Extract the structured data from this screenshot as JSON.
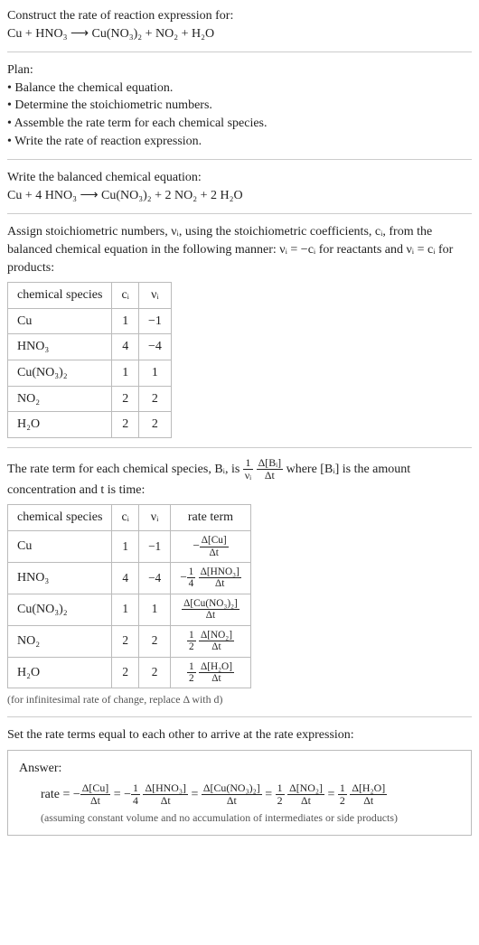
{
  "problem": {
    "title": "Construct the rate of reaction expression for:",
    "equation": "Cu + HNO₃ ⟶ Cu(NO₃)₂ + NO₂ + H₂O"
  },
  "plan": {
    "title": "Plan:",
    "bullets": [
      "Balance the chemical equation.",
      "Determine the stoichiometric numbers.",
      "Assemble the rate term for each chemical species.",
      "Write the rate of reaction expression."
    ]
  },
  "balanced": {
    "title": "Write the balanced chemical equation:",
    "equation": "Cu + 4 HNO₃ ⟶ Cu(NO₃)₂ + 2 NO₂ + 2 H₂O"
  },
  "stoich": {
    "intro_a": "Assign stoichiometric numbers, νᵢ, using the stoichiometric coefficients, cᵢ, from the balanced chemical equation in the following manner: νᵢ = −cᵢ for reactants and νᵢ = cᵢ for products:",
    "headers": {
      "species": "chemical species",
      "c": "cᵢ",
      "nu": "νᵢ"
    },
    "rows": [
      {
        "species": "Cu",
        "c": "1",
        "nu": "−1"
      },
      {
        "species": "HNO₃",
        "c": "4",
        "nu": "−4"
      },
      {
        "species": "Cu(NO₃)₂",
        "c": "1",
        "nu": "1"
      },
      {
        "species": "NO₂",
        "c": "2",
        "nu": "2"
      },
      {
        "species": "H₂O",
        "c": "2",
        "nu": "2"
      }
    ]
  },
  "rate_intro": {
    "part1": "The rate term for each chemical species, Bᵢ, is ",
    "part2": " where [Bᵢ] is the amount concentration and t is time:"
  },
  "rate_table": {
    "headers": {
      "species": "chemical species",
      "c": "cᵢ",
      "nu": "νᵢ",
      "term": "rate term"
    },
    "rows": [
      {
        "species": "Cu",
        "c": "1",
        "nu": "−1",
        "term_num": "Δ[Cu]",
        "term_prefix": "−",
        "term_coef_num": "",
        "term_coef_den": ""
      },
      {
        "species": "HNO₃",
        "c": "4",
        "nu": "−4",
        "term_num": "Δ[HNO₃]",
        "term_prefix": "−",
        "term_coef_num": "1",
        "term_coef_den": "4"
      },
      {
        "species": "Cu(NO₃)₂",
        "c": "1",
        "nu": "1",
        "term_num": "Δ[Cu(NO₃)₂]",
        "term_prefix": "",
        "term_coef_num": "",
        "term_coef_den": ""
      },
      {
        "species": "NO₂",
        "c": "2",
        "nu": "2",
        "term_num": "Δ[NO₂]",
        "term_prefix": "",
        "term_coef_num": "1",
        "term_coef_den": "2"
      },
      {
        "species": "H₂O",
        "c": "2",
        "nu": "2",
        "term_num": "Δ[H₂O]",
        "term_prefix": "",
        "term_coef_num": "1",
        "term_coef_den": "2"
      }
    ],
    "note": "(for infinitesimal rate of change, replace Δ with d)"
  },
  "final": {
    "title": "Set the rate terms equal to each other to arrive at the rate expression:",
    "answer_label": "Answer:",
    "rate_label": "rate = ",
    "terms": [
      {
        "prefix": "−",
        "coef_num": "",
        "coef_den": "",
        "num": "Δ[Cu]"
      },
      {
        "prefix": "−",
        "coef_num": "1",
        "coef_den": "4",
        "num": "Δ[HNO₃]"
      },
      {
        "prefix": "",
        "coef_num": "",
        "coef_den": "",
        "num": "Δ[Cu(NO₃)₂]"
      },
      {
        "prefix": "",
        "coef_num": "1",
        "coef_den": "2",
        "num": "Δ[NO₂]"
      },
      {
        "prefix": "",
        "coef_num": "1",
        "coef_den": "2",
        "num": "Δ[H₂O]"
      }
    ],
    "note": "(assuming constant volume and no accumulation of intermediates or side products)"
  },
  "chart_data": {
    "type": "table",
    "tables": [
      {
        "title": "Stoichiometric numbers",
        "columns": [
          "chemical species",
          "cᵢ",
          "νᵢ"
        ],
        "rows": [
          [
            "Cu",
            1,
            -1
          ],
          [
            "HNO₃",
            4,
            -4
          ],
          [
            "Cu(NO₃)₂",
            1,
            1
          ],
          [
            "NO₂",
            2,
            2
          ],
          [
            "H₂O",
            2,
            2
          ]
        ]
      },
      {
        "title": "Rate terms",
        "columns": [
          "chemical species",
          "cᵢ",
          "νᵢ",
          "rate term"
        ],
        "rows": [
          [
            "Cu",
            1,
            -1,
            "−Δ[Cu]/Δt"
          ],
          [
            "HNO₃",
            4,
            -4,
            "−(1/4) Δ[HNO₃]/Δt"
          ],
          [
            "Cu(NO₃)₂",
            1,
            1,
            "Δ[Cu(NO₃)₂]/Δt"
          ],
          [
            "NO₂",
            2,
            2,
            "(1/2) Δ[NO₂]/Δt"
          ],
          [
            "H₂O",
            2,
            2,
            "(1/2) Δ[H₂O]/Δt"
          ]
        ]
      }
    ],
    "rate_expression": "rate = −Δ[Cu]/Δt = −(1/4) Δ[HNO₃]/Δt = Δ[Cu(NO₃)₂]/Δt = (1/2) Δ[NO₂]/Δt = (1/2) Δ[H₂O]/Δt"
  }
}
